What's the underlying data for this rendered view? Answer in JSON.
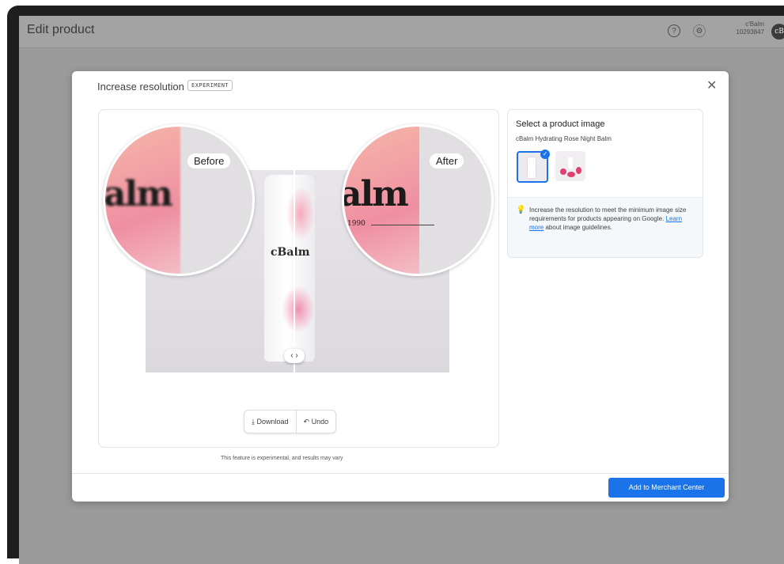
{
  "header": {
    "title": "Edit product",
    "help_icon": "help-circle-icon",
    "settings_icon": "gear-icon",
    "account_name": "c'Balm",
    "account_id": "10293847",
    "avatar_text": "cB"
  },
  "modal": {
    "title": "Increase resolution",
    "badge": "EXPERIMENT",
    "close_icon": "close-icon",
    "viewer": {
      "before_label": "Before",
      "after_label": "After",
      "product_text_before": "alm",
      "product_text_after": "alm",
      "year_text": "1990",
      "tube_logo": "cBalm",
      "handle_glyph": "‹ ›",
      "download_label": "Download",
      "undo_label": "Undo"
    },
    "disclaimer": "This feature is experimental, and results may vary",
    "side_panel": {
      "title": "Select a product image",
      "product_name": "cBalm Hydrating Rose Night Balm",
      "thumbnails": [
        "selected product image",
        "alternate product image"
      ],
      "info_part1": "Increase the resolution to meet the minimum image size requirements for products appearing on Google.",
      "info_link": "Learn more",
      "info_part2": "about image guidelines."
    },
    "primary_button": "Add to Merchant Center"
  },
  "colors": {
    "accent": "#1a73e8",
    "backdrop": "#9b9b9b",
    "frame": "#1f1f1f"
  }
}
